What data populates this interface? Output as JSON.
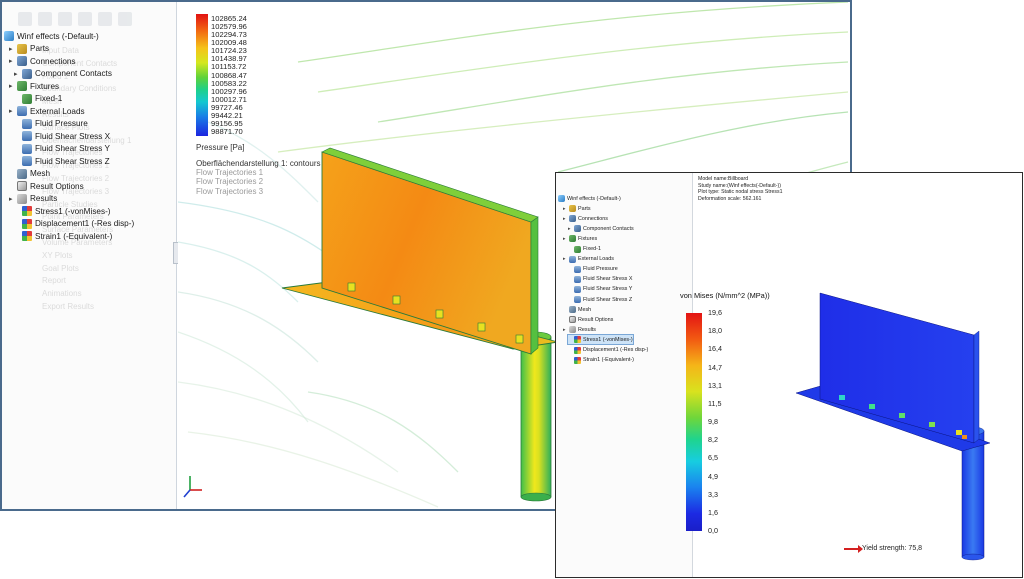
{
  "window_cfd": {
    "tree": {
      "root": "Winf effects (-Default-)",
      "items": [
        {
          "label": "Parts",
          "icon": "parts-icon"
        },
        {
          "label": "Connections",
          "icon": "connections-icon"
        },
        {
          "label": "Component Contacts",
          "icon": "contacts-icon"
        },
        {
          "label": "Fixtures",
          "icon": "fixtures-icon"
        },
        {
          "label": "Fixed-1",
          "icon": "fixed-icon"
        },
        {
          "label": "External Loads",
          "icon": "external-loads-icon"
        },
        {
          "label": "Fluid Pressure",
          "icon": "fluid-pressure-icon"
        },
        {
          "label": "Fluid Shear Stress X",
          "icon": "shear-stress-icon"
        },
        {
          "label": "Fluid Shear Stress Y",
          "icon": "shear-stress-icon"
        },
        {
          "label": "Fluid Shear Stress Z",
          "icon": "shear-stress-icon"
        },
        {
          "label": "Mesh",
          "icon": "mesh-icon"
        },
        {
          "label": "Result Options",
          "icon": "result-options-icon"
        },
        {
          "label": "Results",
          "icon": "results-folder-icon"
        },
        {
          "label": "Stress1 (-vonMises-)",
          "icon": "plot-icon"
        },
        {
          "label": "Displacement1 (-Res disp-)",
          "icon": "plot-icon"
        },
        {
          "label": "Strain1 (-Equivalent-)",
          "icon": "plot-icon"
        }
      ],
      "ghost_items": [
        "Input Data",
        "Component Contacts",
        "Fixed 1",
        "Boundary Conditions",
        "Mesh",
        "Results",
        "Surface Plots",
        "Oberflächendarstellung 1",
        "Flow Trajectories",
        "Flow Trajectories 1",
        "Flow Trajectories 2",
        "Flow Trajectories 3",
        "Particle Studies",
        "Point Parameters",
        "Surface Parameters",
        "Volume Parameters",
        "XY Plots",
        "Goal Plots",
        "Report",
        "Animations",
        "Export Results"
      ]
    },
    "legend": {
      "values": [
        "102865.24",
        "102579.96",
        "102294.73",
        "102009.48",
        "101724.23",
        "101438.97",
        "101153.72",
        "100868.47",
        "100583.22",
        "100297.96",
        "100012.71",
        "99727.46",
        "99442.21",
        "99156.95",
        "98871.70"
      ],
      "unit_label": "Pressure [Pa]"
    },
    "plot_labels": [
      {
        "text": "Oberflächendarstellung 1: contours",
        "faded": false
      },
      {
        "text": "Flow Trajectories 1",
        "faded": true
      },
      {
        "text": "Flow Trajectories 2",
        "faded": true
      },
      {
        "text": "Flow Trajectories 3",
        "faded": true
      }
    ]
  },
  "window_fea": {
    "tree": {
      "root": "Winf effects (-Default-)",
      "items": [
        {
          "label": "Parts",
          "icon": "parts-icon"
        },
        {
          "label": "Connections",
          "icon": "connections-icon"
        },
        {
          "label": "Component Contacts",
          "icon": "contacts-icon"
        },
        {
          "label": "Fixtures",
          "icon": "fixtures-icon"
        },
        {
          "label": "Fixed-1",
          "icon": "fixed-icon"
        },
        {
          "label": "External Loads",
          "icon": "external-loads-icon"
        },
        {
          "label": "Fluid Pressure",
          "icon": "fluid-pressure-icon"
        },
        {
          "label": "Fluid Shear Stress X",
          "icon": "shear-stress-icon"
        },
        {
          "label": "Fluid Shear Stress Y",
          "icon": "shear-stress-icon"
        },
        {
          "label": "Fluid Shear Stress Z",
          "icon": "shear-stress-icon"
        },
        {
          "label": "Mesh",
          "icon": "mesh-icon"
        },
        {
          "label": "Result Options",
          "icon": "result-options-icon"
        },
        {
          "label": "Results",
          "icon": "results-folder-icon"
        },
        {
          "label": "Stress1 (-vonMises-)",
          "icon": "plot-icon"
        },
        {
          "label": "Displacement1 (-Res disp-)",
          "icon": "plot-icon"
        },
        {
          "label": "Strain1 (-Equivalent-)",
          "icon": "plot-icon"
        }
      ]
    },
    "info_lines": [
      "Model name:Billboard",
      "Study name:(Winf effects(-Default-))",
      "Plot type: Static nodal stress Stress1",
      "Deformation scale: 562.161"
    ],
    "legend": {
      "title": "von Mises (N/mm^2 (MPa))",
      "values": [
        "19,6",
        "18,0",
        "16,4",
        "14,7",
        "13,1",
        "11,5",
        "9,8",
        "8,2",
        "6,5",
        "4,9",
        "3,3",
        "1,6",
        "0,0"
      ],
      "yield_label": "Yield strength: 75,8"
    }
  },
  "colors": {
    "window_border": "#4a6a8c",
    "selected_item": "#cde3f7"
  }
}
